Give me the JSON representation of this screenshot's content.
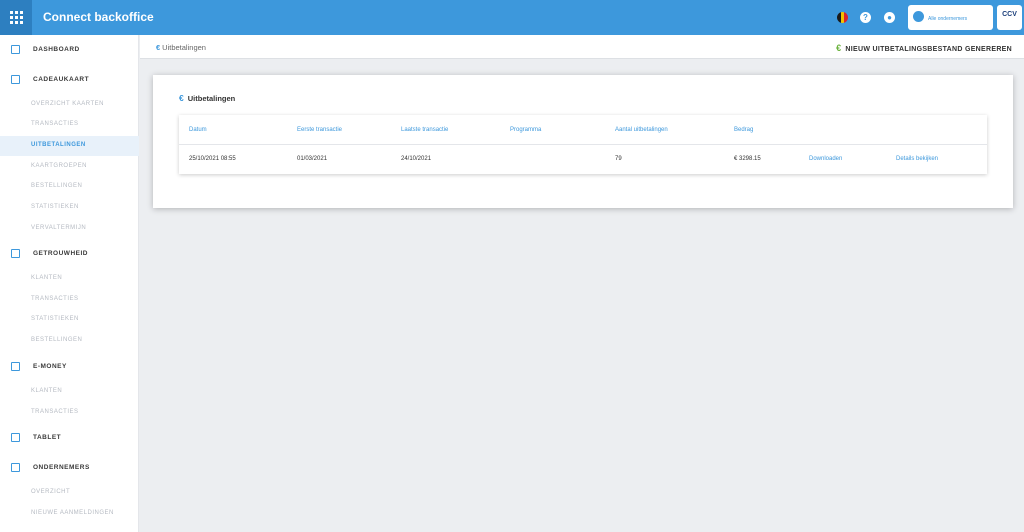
{
  "header": {
    "app_title": "Connect backoffice",
    "merchant_label": "Alle ondernemers",
    "logo_text": "CCV"
  },
  "breadcrumb": {
    "label": "Uitbetalingen"
  },
  "toolbar": {
    "generate_label": "NIEUW UITBETALINGSBESTAND GENEREREN"
  },
  "sidebar": {
    "items": [
      {
        "label": "DASHBOARD",
        "type": "head",
        "icon": "dashboard-icon"
      },
      {
        "label": "CADEAUKAART",
        "type": "head",
        "icon": "gift-card-icon"
      },
      {
        "label": "OVERZICHT KAARTEN",
        "type": "sub"
      },
      {
        "label": "TRANSACTIES",
        "type": "sub"
      },
      {
        "label": "UITBETALINGEN",
        "type": "sub",
        "active": true
      },
      {
        "label": "KAARTGROEPEN",
        "type": "sub"
      },
      {
        "label": "BESTELLINGEN",
        "type": "sub"
      },
      {
        "label": "STATISTIEKEN",
        "type": "sub"
      },
      {
        "label": "VERVALTERMIJN",
        "type": "sub"
      },
      {
        "label": "GETROUWHEID",
        "type": "head",
        "icon": "loyalty-tag-icon"
      },
      {
        "label": "KLANTEN",
        "type": "sub"
      },
      {
        "label": "TRANSACTIES",
        "type": "sub"
      },
      {
        "label": "STATISTIEKEN",
        "type": "sub"
      },
      {
        "label": "BESTELLINGEN",
        "type": "sub"
      },
      {
        "label": "E-MONEY",
        "type": "head",
        "icon": "credit-card-icon"
      },
      {
        "label": "KLANTEN",
        "type": "sub"
      },
      {
        "label": "TRANSACTIES",
        "type": "sub"
      },
      {
        "label": "TABLET",
        "type": "head",
        "icon": "tablet-icon"
      },
      {
        "label": "ONDERNEMERS",
        "type": "head",
        "icon": "store-icon"
      },
      {
        "label": "OVERZICHT",
        "type": "sub"
      },
      {
        "label": "NIEUWE AANMELDINGEN",
        "type": "sub"
      }
    ]
  },
  "card": {
    "title": "Uitbetalingen",
    "columns": [
      "Datum",
      "Eerste transactie",
      "Laatste transactie",
      "Programma",
      "Aantal uitbetalingen",
      "Bedrag"
    ],
    "rows": [
      {
        "datum": "25/10/2021 08:55",
        "eerste": "01/03/2021",
        "laatste": "24/10/2021",
        "programma": "",
        "aantal": "79",
        "bedrag": "€ 3298.15",
        "download": "Downloaden",
        "details": "Details bekijken"
      }
    ]
  },
  "colors": {
    "primary": "#3d98dc",
    "accent_green": "#6cb33f",
    "background": "#eceef1"
  }
}
